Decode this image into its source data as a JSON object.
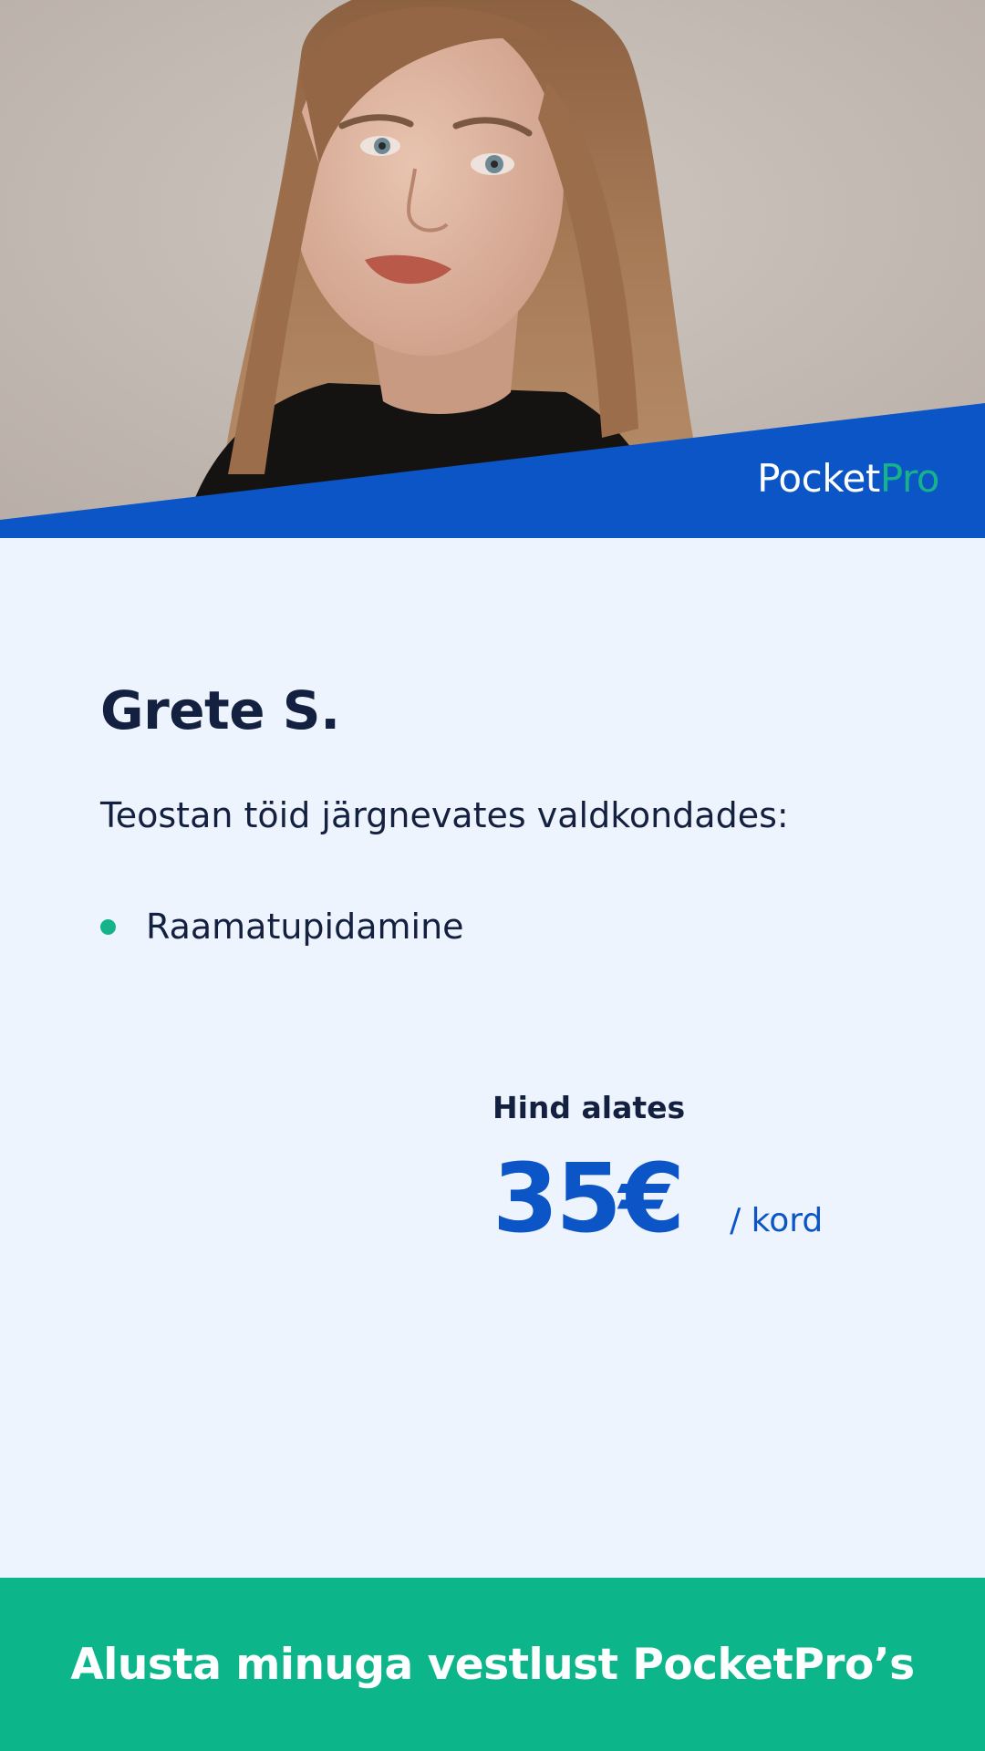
{
  "header": {
    "brand_part1": "Pocket",
    "brand_part2": "Pro",
    "brand_color": "#0B55C6",
    "accent_color": "#16B38A"
  },
  "profile": {
    "name": "Grete S.",
    "intro": "Teostan töid järgnevates valdkondades:",
    "services": [
      "Raamatupidamine"
    ]
  },
  "pricing": {
    "label": "Hind alates",
    "amount": "35€",
    "unit": "/ kord"
  },
  "cta": {
    "label": "Alusta minuga vestlust PocketPro’s"
  }
}
